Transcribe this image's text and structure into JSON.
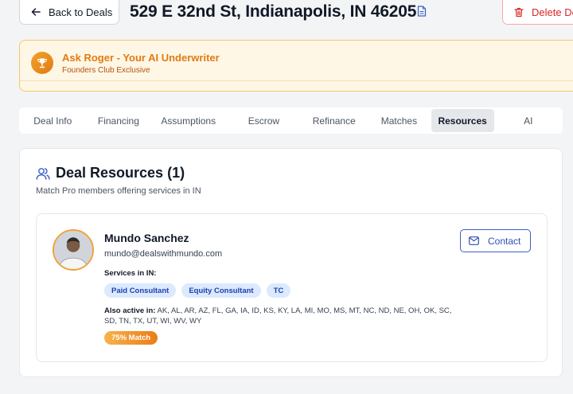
{
  "header": {
    "back_label": "Back to Deals",
    "title": "529 E 32nd St, Indianapolis, IN 46205",
    "delete_label": "Delete Deal"
  },
  "roger": {
    "title": "Ask Roger - Your AI Underwriter",
    "subtitle": "Founders Club Exclusive"
  },
  "tabs": [
    {
      "label": "Deal Info"
    },
    {
      "label": "Financing"
    },
    {
      "label": "Assumptions"
    },
    {
      "label": "Escrow"
    },
    {
      "label": "Refinance"
    },
    {
      "label": "Matches"
    },
    {
      "label": "Resources",
      "active": true
    },
    {
      "label": "AI"
    }
  ],
  "resources": {
    "title": "Deal Resources (1)",
    "subtitle": "Match Pro members offering services in IN",
    "member": {
      "name": "Mundo Sanchez",
      "email": "mundo@dealswithmundo.com",
      "services_label": "Services in IN:",
      "services": [
        "Paid Consultant",
        "Equity Consultant",
        "TC"
      ],
      "also_active_label": "Also active in:",
      "also_active_states": "AK, AL, AR, AZ, FL, GA, IA, ID, KS, KY, LA, MI, MO, MS, MT, NC, ND, NE, OH, OK, SC, SD, TN, TX, UT, WI, WV, WY",
      "match": "75% Match",
      "contact_label": "Contact"
    }
  },
  "colors": {
    "accent_orange": "#e07b12",
    "accent_blue": "#2f4fb3",
    "danger": "#dc2626",
    "chip_bg": "#dbeafe"
  }
}
